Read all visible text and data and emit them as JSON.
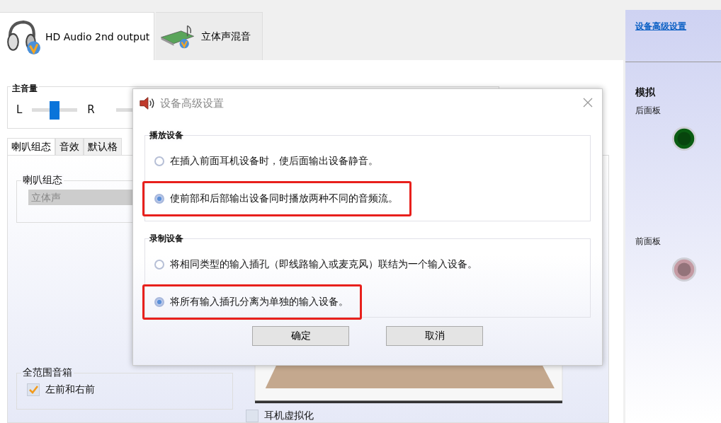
{
  "device_tabs": [
    {
      "label": "HD Audio 2nd output",
      "selected": true,
      "kind": "headphones"
    },
    {
      "label": "立体声混音",
      "selected": false,
      "kind": "card"
    }
  ],
  "master_volume": {
    "label": "主音量",
    "left": "L",
    "right": "R",
    "level": 0.5
  },
  "tabs": [
    {
      "label": "喇叭组态",
      "selected": true
    },
    {
      "label": "音效",
      "selected": false
    },
    {
      "label": "默认格",
      "selected": false
    }
  ],
  "speaker_config": {
    "label": "喇叭组态",
    "value": "立体声",
    "disabled": true
  },
  "full_range": {
    "label": "全范围音箱",
    "options": [
      {
        "label": "左前和右前",
        "checked": true
      }
    ]
  },
  "headphone_virtualization": {
    "label": "耳机虚拟化",
    "checked": false
  },
  "side_panel": {
    "link": "设备高级设置",
    "heading": "模拟",
    "jacks": [
      {
        "label": "后面板",
        "color": "#0a5c12"
      },
      {
        "label": "前面板",
        "color": "#c49aa3"
      }
    ]
  },
  "dialog": {
    "title": "设备高级设置",
    "groups": [
      {
        "label": "播放设备",
        "options": [
          {
            "label": "在插入前面耳机设备时，使后面输出设备静音。",
            "selected": false,
            "highlighted": false
          },
          {
            "label": "使前部和后部输出设备同时播放两种不同的音频流。",
            "selected": true,
            "highlighted": true
          }
        ]
      },
      {
        "label": "录制设备",
        "options": [
          {
            "label": "将相同类型的输入插孔（即线路输入或麦克风）联结为一个输入设备。",
            "selected": false,
            "highlighted": false
          },
          {
            "label": "将所有输入插孔分离为单独的输入设备。",
            "selected": true,
            "highlighted": true
          }
        ]
      }
    ],
    "buttons": [
      "确定",
      "取消"
    ]
  }
}
